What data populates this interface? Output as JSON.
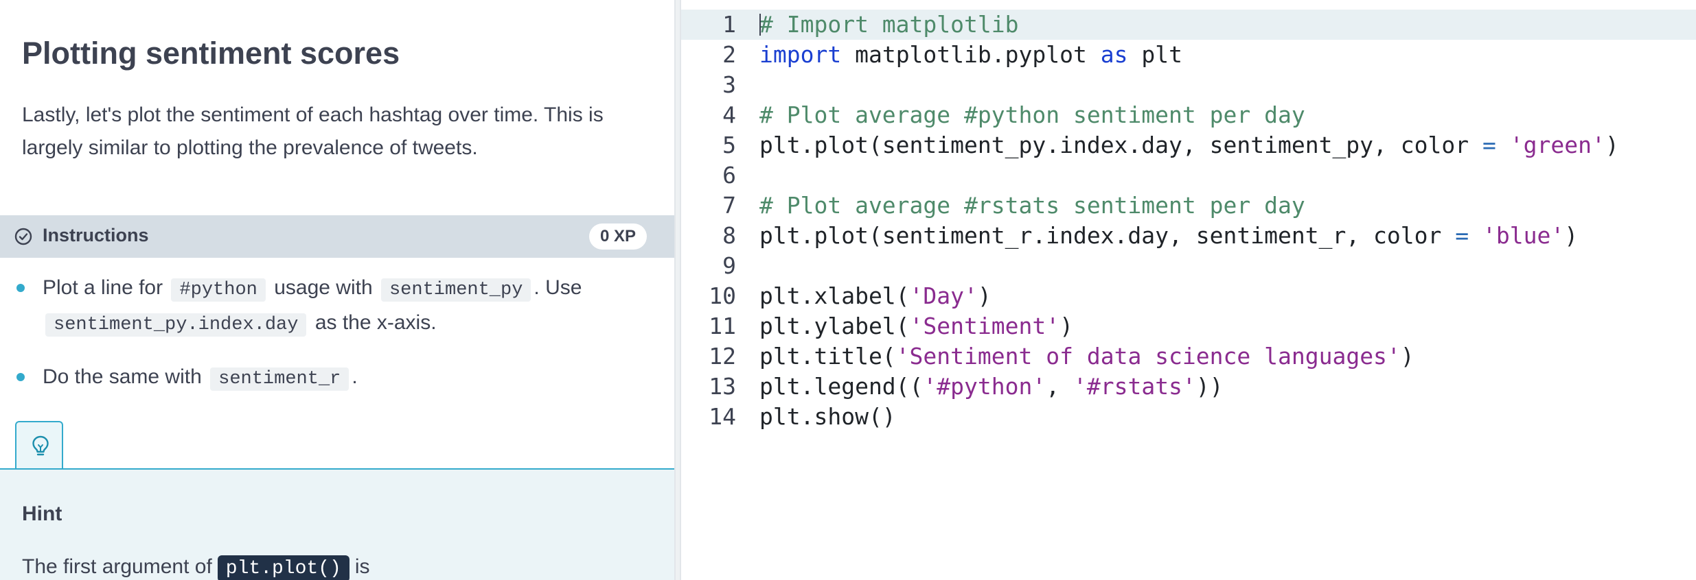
{
  "exercise": {
    "title": "Plotting sentiment scores",
    "description": "Lastly, let's plot the sentiment of each hashtag over time. This is largely similar to plotting the prevalence of tweets."
  },
  "instructions": {
    "label": "Instructions",
    "xp": "0 XP",
    "icon": "check-circle-icon",
    "bullet1": {
      "t1": "Plot a line for",
      "c1": "#python",
      "t2": "usage with",
      "c2": "sentiment_py",
      "t3": ". Use",
      "c3": "sentiment_py.index.day",
      "t4": "as the x-axis."
    },
    "bullet2": {
      "t1": "Do the same with",
      "c1": "sentiment_r",
      "t2": "."
    }
  },
  "hint": {
    "tab_icon": "lightbulb-icon",
    "title": "Hint",
    "text_start": "The first argument of",
    "code": "plt.plot()",
    "text_end": "is"
  },
  "editor": {
    "active_line": 1,
    "lines": [
      {
        "n": "1",
        "tokens": [
          {
            "t": "# Import matplotlib",
            "k": "comment"
          }
        ]
      },
      {
        "n": "2",
        "tokens": [
          {
            "t": "import",
            "k": "kw"
          },
          {
            "t": " matplotlib.pyplot ",
            "k": "plain"
          },
          {
            "t": "as",
            "k": "kw"
          },
          {
            "t": " plt",
            "k": "plain"
          }
        ]
      },
      {
        "n": "3",
        "tokens": []
      },
      {
        "n": "4",
        "tokens": [
          {
            "t": "# Plot average #python sentiment per day",
            "k": "comment"
          }
        ]
      },
      {
        "n": "5",
        "tokens": [
          {
            "t": "plt.plot(sentiment_py.index.day, sentiment_py, color ",
            "k": "plain"
          },
          {
            "t": "=",
            "k": "op"
          },
          {
            "t": " ",
            "k": "plain"
          },
          {
            "t": "'green'",
            "k": "str"
          },
          {
            "t": ")",
            "k": "plain"
          }
        ]
      },
      {
        "n": "6",
        "tokens": []
      },
      {
        "n": "7",
        "tokens": [
          {
            "t": "# Plot average #rstats sentiment per day",
            "k": "comment"
          }
        ]
      },
      {
        "n": "8",
        "tokens": [
          {
            "t": "plt.plot(sentiment_r.index.day, sentiment_r, color ",
            "k": "plain"
          },
          {
            "t": "=",
            "k": "op"
          },
          {
            "t": " ",
            "k": "plain"
          },
          {
            "t": "'blue'",
            "k": "str"
          },
          {
            "t": ")",
            "k": "plain"
          }
        ]
      },
      {
        "n": "9",
        "tokens": []
      },
      {
        "n": "10",
        "tokens": [
          {
            "t": "plt.xlabel(",
            "k": "plain"
          },
          {
            "t": "'Day'",
            "k": "str"
          },
          {
            "t": ")",
            "k": "plain"
          }
        ]
      },
      {
        "n": "11",
        "tokens": [
          {
            "t": "plt.ylabel(",
            "k": "plain"
          },
          {
            "t": "'Sentiment'",
            "k": "str"
          },
          {
            "t": ")",
            "k": "plain"
          }
        ]
      },
      {
        "n": "12",
        "tokens": [
          {
            "t": "plt.title(",
            "k": "plain"
          },
          {
            "t": "'Sentiment of data science languages'",
            "k": "str"
          },
          {
            "t": ")",
            "k": "plain"
          }
        ]
      },
      {
        "n": "13",
        "tokens": [
          {
            "t": "plt.legend((",
            "k": "plain"
          },
          {
            "t": "'#python'",
            "k": "str"
          },
          {
            "t": ", ",
            "k": "plain"
          },
          {
            "t": "'#rstats'",
            "k": "str"
          },
          {
            "t": "))",
            "k": "plain"
          }
        ]
      },
      {
        "n": "14",
        "tokens": [
          {
            "t": "plt.show()",
            "k": "plain"
          }
        ]
      }
    ]
  }
}
